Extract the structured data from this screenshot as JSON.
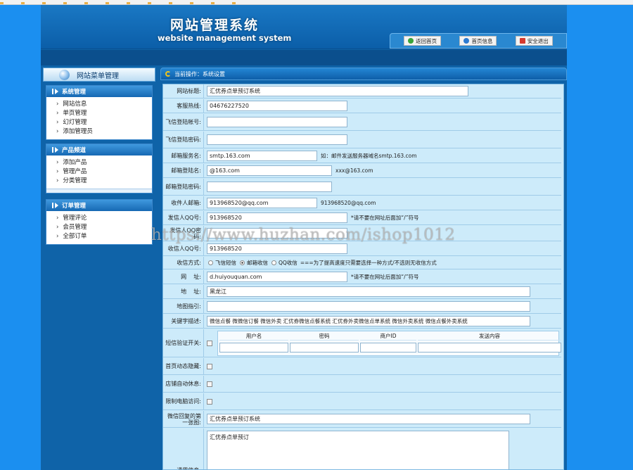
{
  "bookmarks": [
    "",
    "",
    "",
    "",
    "",
    "",
    "",
    "",
    "",
    "",
    "",
    "",
    "",
    "",
    "",
    "",
    "",
    "",
    "",
    "",
    "",
    ""
  ],
  "header": {
    "title": "网站管理系统",
    "subtitle": "website management system",
    "nav": [
      {
        "label": "返回首页",
        "icon": "home-icon",
        "color": "#3aa33a"
      },
      {
        "label": "首页信息",
        "icon": "info-icon",
        "color": "#2d7bd1"
      },
      {
        "label": "安全退出",
        "icon": "exit-icon",
        "color": "#d63a2e"
      }
    ]
  },
  "sidebar": {
    "title": "网站菜单管理",
    "groups": [
      {
        "title": "系统管理",
        "items": [
          "网站信息",
          "单页管理",
          "幻灯管理",
          "添加管理员"
        ]
      },
      {
        "title": "产品频道",
        "items": [
          "添加产品",
          "管理产品",
          "分类管理"
        ]
      },
      {
        "title": "订单管理",
        "items": [
          "管理评论",
          "会员管理",
          "全部订单"
        ]
      }
    ]
  },
  "breadcrumb": {
    "prefix": "当前操作：",
    "current": "系统设置"
  },
  "form": {
    "site_title": {
      "label": "网站标题:",
      "value": "汇优券点单预订系统"
    },
    "hotline": {
      "label": "客服热线:",
      "value": "04676227520"
    },
    "fetion_account": {
      "label": "飞信登陆帐号:",
      "value": ""
    },
    "fetion_password": {
      "label": "飞信登陆密码:",
      "value": ""
    },
    "mail_server": {
      "label": "邮箱服务名:",
      "value": "smtp.163.com",
      "note": "如：邮件发送服务器域名smtp.163.com"
    },
    "mail_login": {
      "label": "邮箱登陆名:",
      "value": "@163.com",
      "note": "xxx@163.com"
    },
    "mail_password": {
      "label": "邮箱登陆密码:",
      "value": ""
    },
    "recipient_email": {
      "label": "收件人邮箱:",
      "value": "913968520@qq.com",
      "note": "913968520@qq.com"
    },
    "sender_qq": {
      "label": "发信人QQ号:",
      "value": "913968520",
      "note": "*请不要在网址后面加“/”符号"
    },
    "sender_qq_password": {
      "label": "发信人QQ密码:",
      "value": ""
    },
    "receiver_qq": {
      "label": "收信人QQ号:",
      "value": "913968520"
    },
    "receive_method": {
      "label": "收信方式:",
      "options": [
        "飞信短信",
        "邮箱收信",
        "QQ收信"
      ],
      "selected": "邮箱收信",
      "note": "===为了提高速度只需要选择一种方式/不选则无收信方式"
    },
    "website": {
      "label": "网    址:",
      "value": "d.huiyouquan.com",
      "note": "*请不要在网址后面加“/”符号"
    },
    "address": {
      "label": "地    址:",
      "value": "黑龙江"
    },
    "map_guide": {
      "label": "地图指引:",
      "value": ""
    },
    "keywords": {
      "label": "关键字描述:",
      "value": "微信点餐 微微信订餐 微信外卖 汇优券微信点餐系统 汇优券外卖微信点单系统 微信外卖系统 微信点餐外卖系统"
    },
    "sms_verify": {
      "label": "短信验证开关:",
      "columns": [
        "用户名",
        "密码",
        "商户ID",
        "发送内容"
      ]
    },
    "home_hide": {
      "label": "首页动态隐藏:"
    },
    "auto_rest": {
      "label": "店铺自动休息:"
    },
    "limit_pc": {
      "label": "限制电脑访问:"
    },
    "wechat_first": {
      "label": "微信回复的第一张图:",
      "value": "汇优券点单预订系统"
    },
    "general_info": {
      "label": "通用信息:",
      "value": "汇优券点单预订"
    }
  },
  "watermark": "https://www.huzhan.com/ishop1012"
}
